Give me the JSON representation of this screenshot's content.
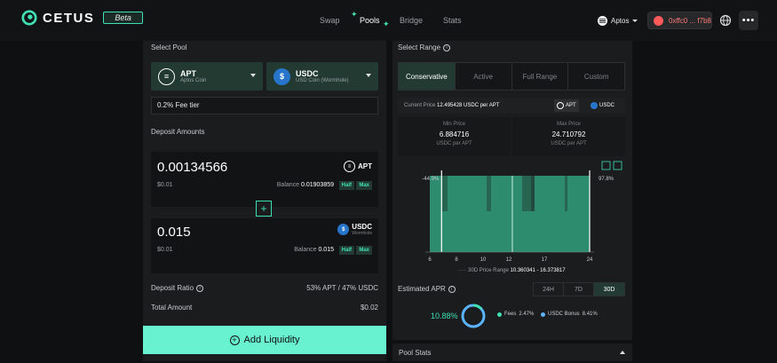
{
  "header": {
    "logo_text": "CETUS",
    "beta_label": "Beta",
    "nav": [
      "Swap",
      "Pools",
      "Bridge",
      "Stats"
    ],
    "chain": "Aptos",
    "wallet": "0xffc0 ... f7b8"
  },
  "left": {
    "select_pool_label": "Select Pool",
    "token_a": {
      "symbol": "APT",
      "name": "Aptos Coin"
    },
    "token_b": {
      "symbol": "USDC",
      "name": "USD Coin (Wormhole)"
    },
    "fee_tier": "0.2% Fee tier",
    "deposit_label": "Deposit Amounts",
    "deposit_a": {
      "amount": "0.00134566",
      "usd": "$0.01",
      "balance_label": "Balance",
      "balance": "0.01903859",
      "token": "APT"
    },
    "deposit_b": {
      "amount": "0.015",
      "usd": "$0.01",
      "balance_label": "Balance",
      "balance": "0.015",
      "token": "USDC",
      "token_sub": "Wormhole"
    },
    "half": "Half",
    "max": "Max",
    "ratio_label": "Deposit Ratio",
    "ratio_value": "53% APT / 47% USDC",
    "total_label": "Total Amount",
    "total_value": "$0.02",
    "add_button": "Add Liquidity"
  },
  "right": {
    "select_range_label": "Select Range",
    "tabs": [
      "Conservative",
      "Active",
      "Full Range",
      "Custom"
    ],
    "current_price_label": "Current Price",
    "current_price": "12.495428 USDC per APT",
    "toggle_a": "APT",
    "toggle_b": "USDC",
    "min_label": "Min Price",
    "min_value": "6.884716",
    "min_unit": "USDC per APT",
    "max_label": "Max Price",
    "max_value": "24.710792",
    "max_unit": "USDC per APT",
    "range_label": "30D Price Range",
    "range_value": "10.360341 - 16.373817",
    "apr_label": "Estimated APR",
    "apr_tabs": [
      "24H",
      "7D",
      "30D"
    ],
    "apr_value": "10.88%",
    "fees_label": "Fees",
    "fees_value": "2.47%",
    "bonus_label": "USDC Bonus",
    "bonus_value": "8.41%",
    "pool_stats": "Pool Stats"
  },
  "chart_data": {
    "type": "bar",
    "x_ticks": [
      6,
      8,
      10,
      12,
      17,
      24
    ],
    "left_pct": "-44.9%",
    "right_pct": "97.8%",
    "min_price": 6.884716,
    "max_price": 24.710792,
    "current_price": 12.495428
  },
  "colors": {
    "accent": "#3ee0b4",
    "button": "#68f2cf",
    "fill": "#2e8c6e"
  }
}
